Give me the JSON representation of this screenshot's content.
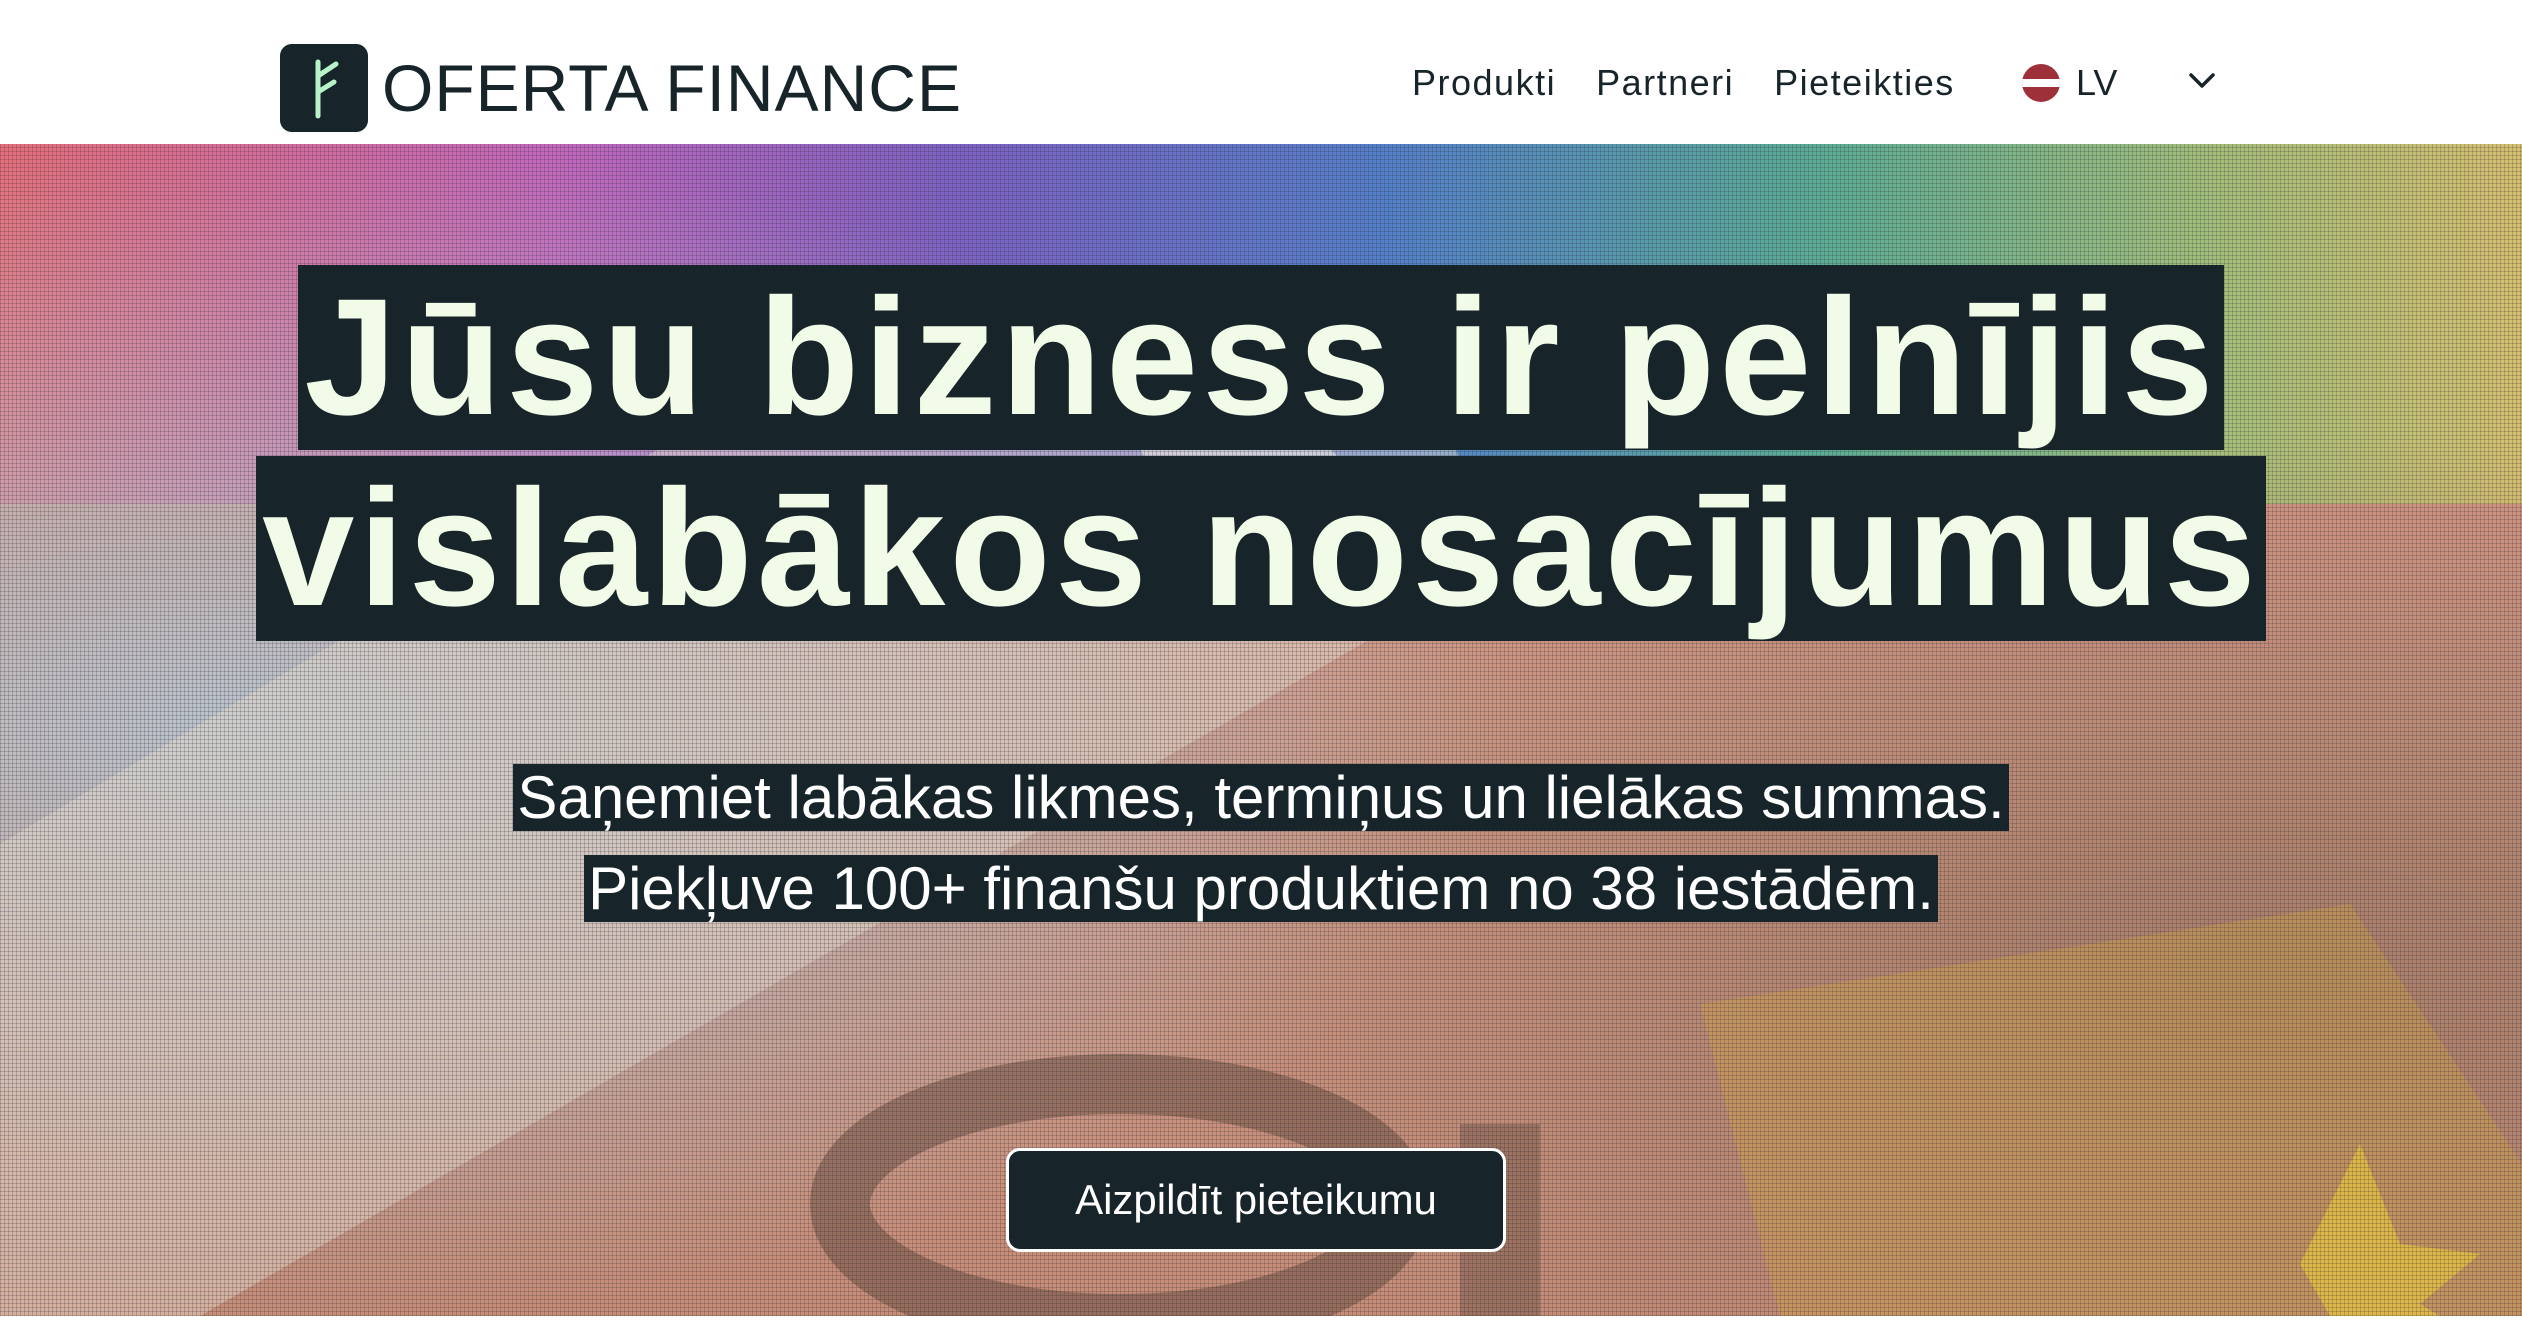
{
  "header": {
    "logo_text": "OFERTA FINANCE",
    "nav": [
      {
        "label": "Produkti"
      },
      {
        "label": "Partneri"
      },
      {
        "label": "Pieteikties"
      }
    ],
    "language": {
      "code": "LV",
      "flag_icon": "latvia-flag-icon"
    }
  },
  "hero": {
    "headline_line1": "Jūsu bizness ir pelnījis",
    "headline_line2": "vislabākos nosacījumus",
    "subtext_line1": "Saņemiet labākas likmes, termiņus un lielākas summas.",
    "subtext_line2": "Piekļuve 100+ finanšu produktiem no 38 iestādēm.",
    "cta_label": "Aizpildīt pieteikumu"
  },
  "colors": {
    "brand_dark": "#17252a",
    "headline_text": "#f2fbe8",
    "logo_accent": "#b8f2c8",
    "flag_red": "#9e3039"
  }
}
